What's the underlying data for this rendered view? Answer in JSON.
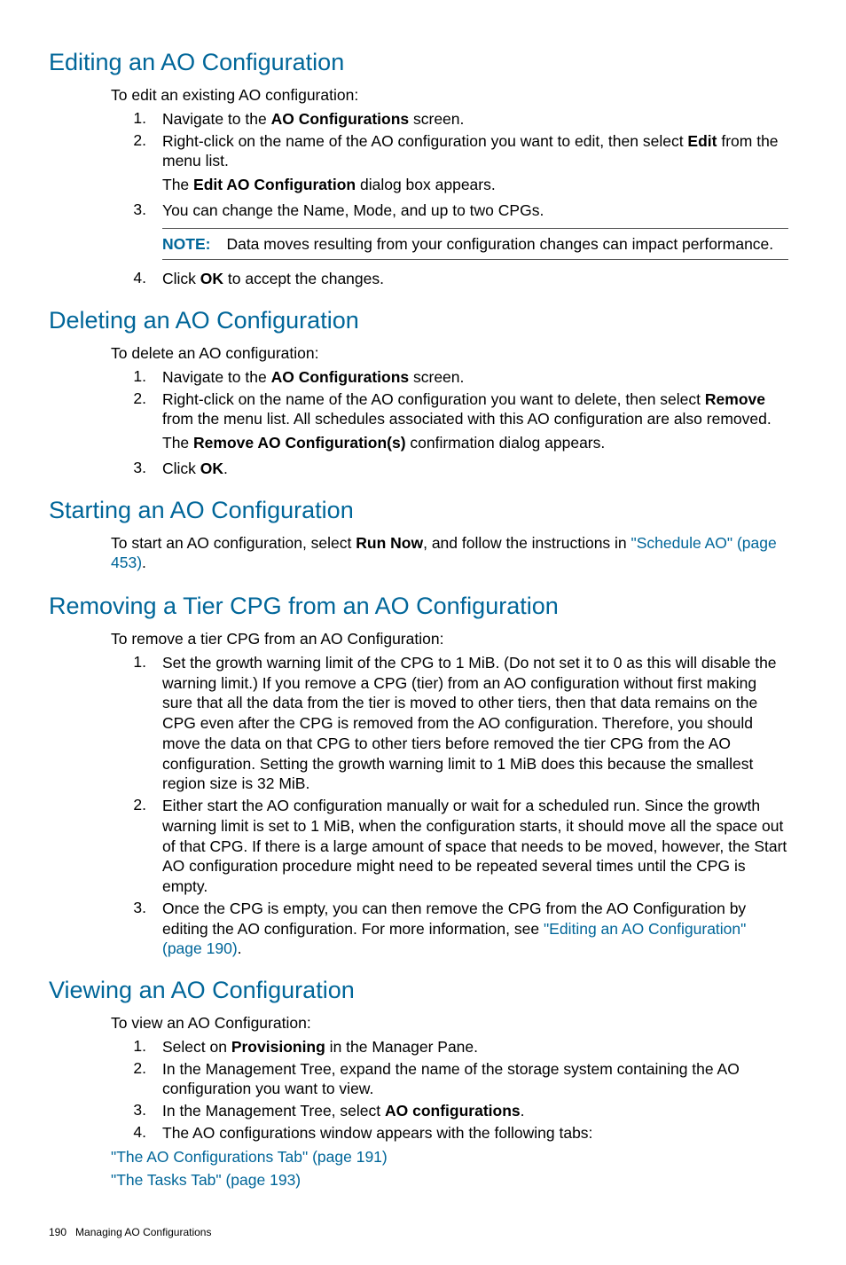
{
  "footer": {
    "page_number": "190",
    "chapter": "Managing AO Configurations"
  },
  "sections": {
    "editing": {
      "heading": "Editing an AO Configuration",
      "intro": "To edit an existing AO configuration:",
      "step1_a": "Navigate to the ",
      "step1_bold": "AO Configurations",
      "step1_b": " screen.",
      "step2_a": "Right-click on the name of the AO configuration you want to edit, then select ",
      "step2_bold": "Edit",
      "step2_b": " from the menu list.",
      "step2_sub_a": "The ",
      "step2_sub_bold": "Edit AO Configuration",
      "step2_sub_b": " dialog box appears.",
      "step3": "You can change the Name, Mode, and up to two CPGs.",
      "note_label": "NOTE:",
      "note_text": "Data moves resulting from your configuration changes can impact performance.",
      "step4_a": "Click ",
      "step4_bold": "OK",
      "step4_b": " to accept the changes."
    },
    "deleting": {
      "heading": "Deleting an AO Configuration",
      "intro": "To delete an AO configuration:",
      "step1_a": "Navigate to the ",
      "step1_bold": "AO Configurations",
      "step1_b": " screen.",
      "step2_a": "Right-click on the name of the AO configuration you want to delete, then select ",
      "step2_bold": "Remove",
      "step2_b": " from the menu list. All schedules associated with this AO configuration are also removed.",
      "step2_sub_a": "The ",
      "step2_sub_bold": "Remove AO Configuration(s)",
      "step2_sub_b": " confirmation dialog appears.",
      "step3_a": "Click ",
      "step3_bold": "OK",
      "step3_b": "."
    },
    "starting": {
      "heading": "Starting an AO Configuration",
      "p_a": "To start an AO configuration, select ",
      "p_bold": "Run Now",
      "p_b": ", and follow the instructions in ",
      "p_link": "\"Schedule AO\" (page 453)",
      "p_c": "."
    },
    "removing": {
      "heading": "Removing a Tier CPG from an AO Configuration",
      "intro": "To remove a tier CPG from an AO Configuration:",
      "step1": "Set the growth warning limit of the CPG to 1 MiB. (Do not set it to 0 as this will disable the warning limit.) If you remove a CPG (tier) from an AO configuration without first making sure that all the data from the tier is moved to other tiers, then that data remains on the CPG even after the CPG is removed from the AO configuration. Therefore, you should move the data on that CPG to other tiers before removed the tier CPG from the AO configuration. Setting the growth warning limit to 1 MiB does this because the smallest region size is 32 MiB.",
      "step2": "Either start the AO configuration manually or wait for a scheduled run. Since the growth warning limit is set to 1 MiB, when the configuration starts, it should move all the space out of that CPG. If there is a large amount of space that needs to be moved, however, the Start AO configuration procedure might need to be repeated several times until the CPG is empty.",
      "step3_a": "Once the CPG is empty, you can then remove the CPG from the AO Configuration by editing the AO configuration. For more information, see ",
      "step3_link": "\"Editing an AO Configuration\" (page 190)",
      "step3_b": "."
    },
    "viewing": {
      "heading": "Viewing an AO Configuration",
      "intro": "To view an AO Configuration:",
      "step1_a": "Select on ",
      "step1_bold": "Provisioning",
      "step1_b": " in the Manager Pane.",
      "step2": "In the Management Tree, expand the name of the storage system containing the AO configuration you want to view.",
      "step3_a": "In the Management Tree, select ",
      "step3_bold": "AO configurations",
      "step3_b": ".",
      "step4": "The AO configurations window appears with the following tabs:",
      "link1": "\"The AO Configurations Tab\" (page 191)",
      "link2": "\"The Tasks Tab\" (page 193)"
    }
  }
}
